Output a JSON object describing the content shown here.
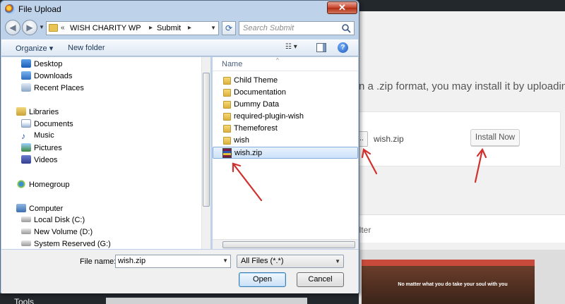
{
  "dialog": {
    "title": "File Upload",
    "close_label": "✕",
    "address": {
      "root_chevron": "«",
      "crumbs": [
        "WISH CHARITY WP",
        "Submit"
      ]
    },
    "search": {
      "placeholder": "Search Submit"
    },
    "toolbar": {
      "organize_label": "Organize ▾",
      "new_folder_label": "New folder"
    },
    "nav": {
      "favorites": [
        "Desktop",
        "Downloads",
        "Recent Places"
      ],
      "libraries_title": "Libraries",
      "libraries": [
        "Documents",
        "Music",
        "Pictures",
        "Videos"
      ],
      "homegroup": "Homegroup",
      "computer_title": "Computer",
      "drives": [
        "Local Disk (C:)",
        "New Volume (D:)",
        "System Reserved (G:)"
      ]
    },
    "files": {
      "column_name": "Name",
      "items": [
        {
          "name": "Child Theme",
          "type": "folder"
        },
        {
          "name": "Documentation",
          "type": "folder"
        },
        {
          "name": "Dummy Data",
          "type": "folder"
        },
        {
          "name": "required-plugin-wish",
          "type": "folder"
        },
        {
          "name": "Themeforest",
          "type": "folder"
        },
        {
          "name": "wish",
          "type": "folder"
        },
        {
          "name": "wish.zip",
          "type": "zip",
          "selected": true
        }
      ]
    },
    "bottom": {
      "file_name_label": "File name:",
      "file_name_value": "wish.zip",
      "file_type": "All Files (*.*)",
      "open_label": "Open",
      "cancel_label": "Cancel"
    }
  },
  "wordpress": {
    "help_text": "n a .zip format, you may install it by uploadin",
    "browse_label": "..",
    "chosen_file": "wish.zip",
    "install_label": "Install Now",
    "filter_label": "ilter",
    "theme_caption": "No matter what you do take your soul with you",
    "tools_label": "Tools"
  },
  "annotations": {
    "arrow_color": "#d0312d"
  }
}
